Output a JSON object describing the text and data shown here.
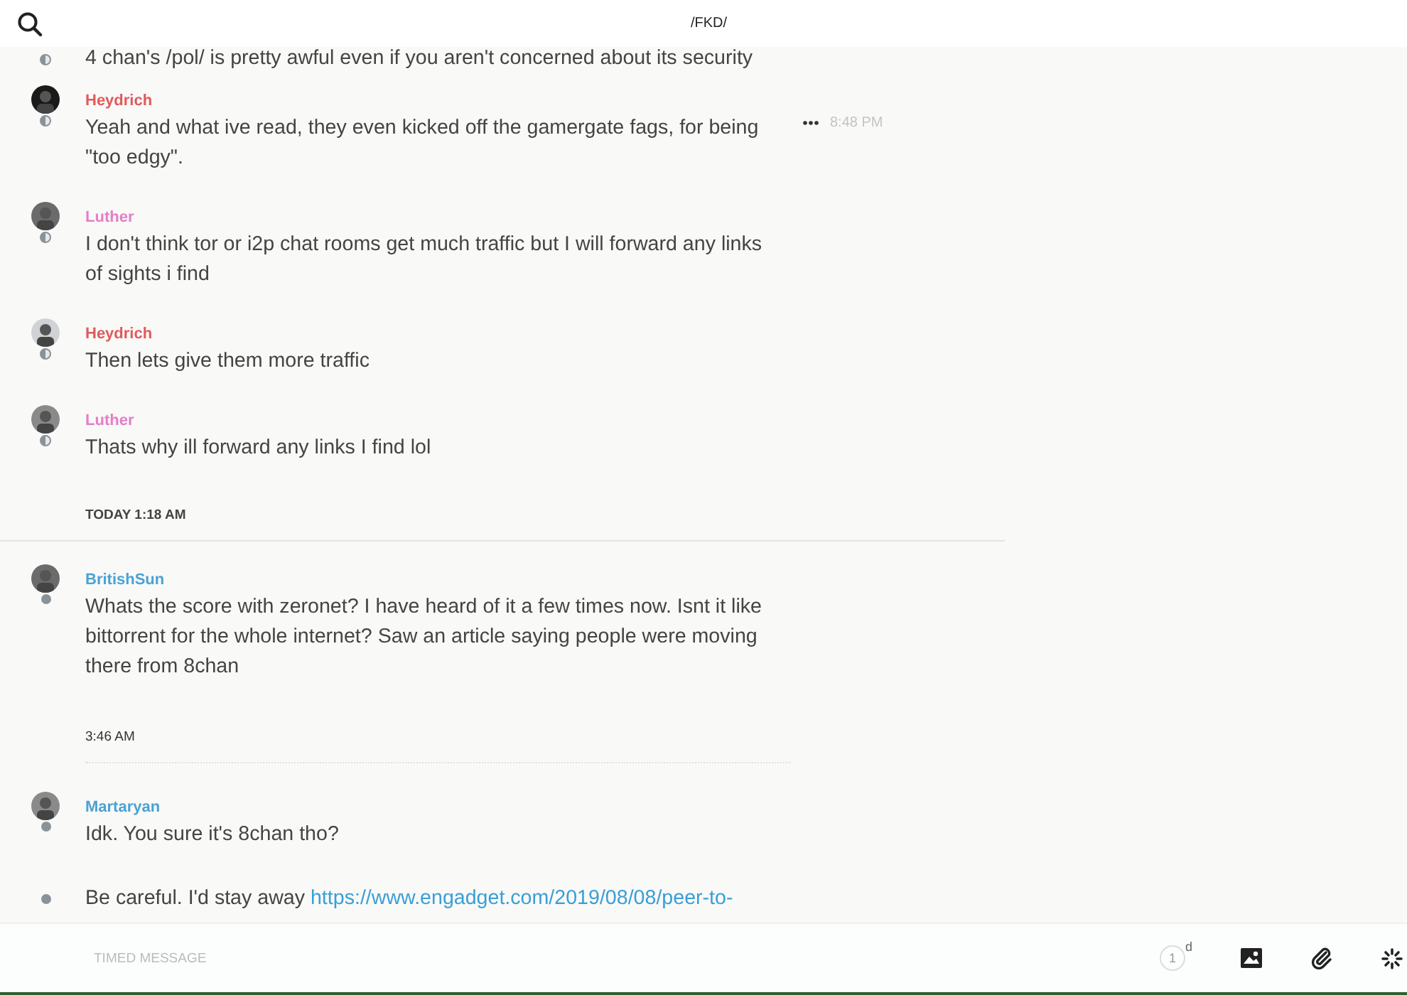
{
  "header": {
    "title": "/FKD/"
  },
  "messages": [
    {
      "kind": "message",
      "delivered": false,
      "text": "4 chan's /pol/ is pretty awful even if you aren't concerned about its security"
    },
    {
      "kind": "message",
      "author": "Heydrich",
      "color": "#e05a5a",
      "avatar": true,
      "delivered": false,
      "text": "Yeah and what ive read, they even kicked off the gamergate fags, for being \"too edgy\".",
      "time": "8:48 PM"
    },
    {
      "kind": "message",
      "author": "Luther",
      "color": "#e57ec8",
      "avatar": true,
      "delivered": false,
      "text": "I don't think tor or i2p chat rooms get much traffic but I will forward any links of sights i find"
    },
    {
      "kind": "message",
      "author": "Heydrich",
      "color": "#e05a5a",
      "avatar": true,
      "delivered": false,
      "text": "Then lets give them more traffic"
    },
    {
      "kind": "message",
      "author": "Luther",
      "color": "#e57ec8",
      "avatar": true,
      "delivered": false,
      "text": "Thats why ill forward any links I find lol"
    },
    {
      "kind": "day",
      "label": "TODAY 1:18 AM"
    },
    {
      "kind": "message",
      "author": "BritishSun",
      "color": "#4aa3d4",
      "avatar": true,
      "delivered": true,
      "text": "Whats the score with zeronet?  I have heard of it a few times now.  Isnt it like bittorrent for the whole internet?  Saw an article saying people were moving there from 8chan"
    },
    {
      "kind": "time",
      "label": "3:46 AM"
    },
    {
      "kind": "message",
      "author": "Martaryan",
      "color": "#4aa3d4",
      "avatar": true,
      "delivered": true,
      "text": "Idk. You sure it's 8chan tho?"
    },
    {
      "kind": "message",
      "delivered": true,
      "text": "Be careful. I'd stay away ",
      "link": "https://www.engadget.com/2019/08/08/peer-to-"
    }
  ],
  "composer": {
    "placeholder": "TIMED MESSAGE",
    "timer": "1",
    "timer_unit": "d"
  }
}
